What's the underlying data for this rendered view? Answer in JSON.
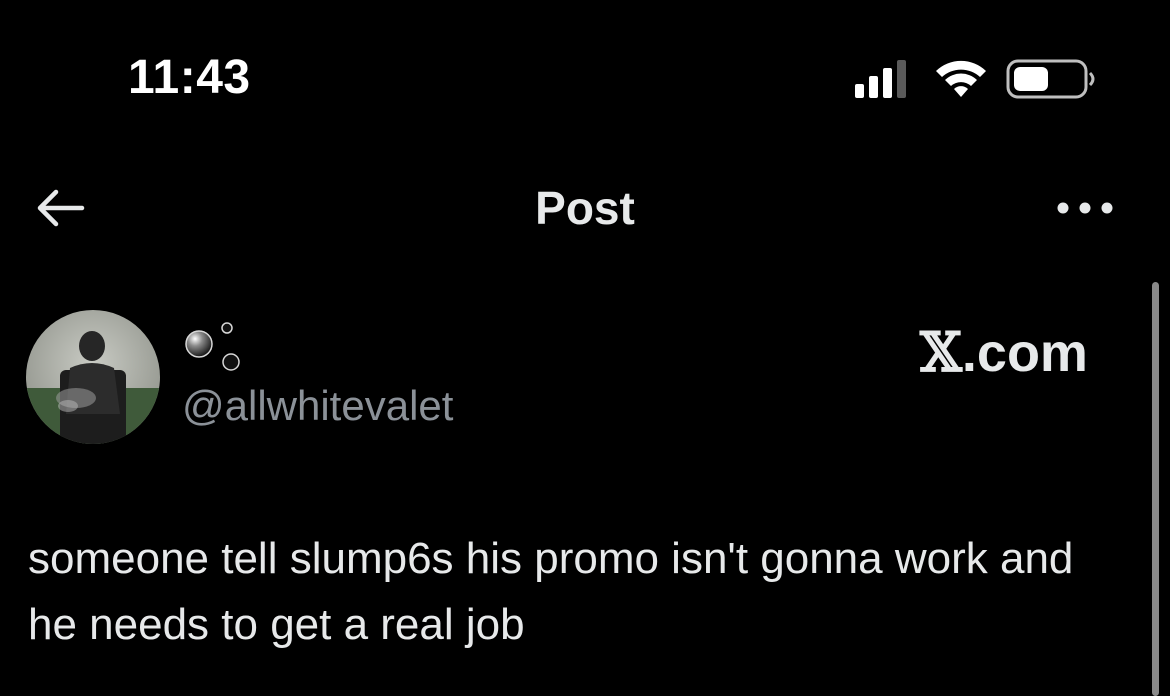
{
  "status_bar": {
    "time": "11:43",
    "signal_icon": "cellular-signal-icon",
    "wifi_icon": "wifi-icon",
    "battery_icon": "battery-icon",
    "battery_level": 0.45
  },
  "header": {
    "back_icon": "arrow-left-icon",
    "title": "Post",
    "more_icon": "more-horizontal-icon"
  },
  "post": {
    "avatar_icon": "avatar-photo",
    "display_name_icon": "bubbles-icon",
    "handle": "@allwhitevalet",
    "text": "someone tell slump6s his promo isn't gonna work and he needs to get a real job"
  },
  "watermark": {
    "x_glyph": "𝕏",
    "domain": ".com"
  },
  "colors": {
    "background": "#000000",
    "text_primary": "#e7e9ea",
    "text_secondary": "#8b9198"
  }
}
